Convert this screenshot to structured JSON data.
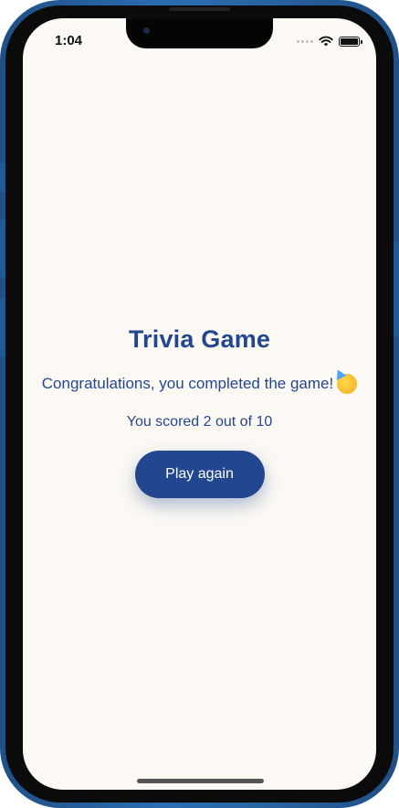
{
  "status_bar": {
    "time": "1:04",
    "icons": [
      "signal-dots-icon",
      "wifi-icon",
      "battery-icon"
    ]
  },
  "main": {
    "title": "Trivia Game",
    "message": "Congratulations, you completed the game!",
    "emoji": "party-face",
    "score_text": "You scored 2 out of 10",
    "play_again_label": "Play again"
  },
  "colors": {
    "accent": "#23478f",
    "background": "#fcf9f4",
    "device_frame": "#2b6cb0"
  }
}
